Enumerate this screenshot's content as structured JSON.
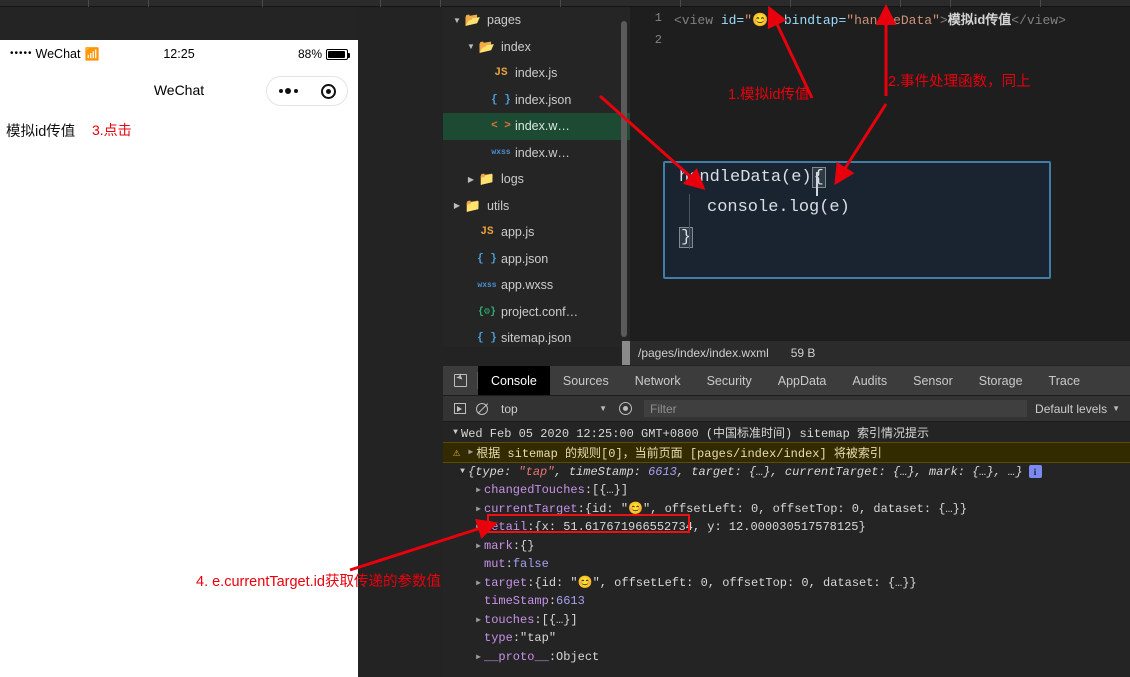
{
  "simulator": {
    "status_bar": {
      "signal_dots": "•••••",
      "carrier": "WeChat",
      "wifi_icon": "wifi-icon",
      "time": "12:25",
      "battery_percent": "88%",
      "battery_icon": "battery-icon"
    },
    "nav_title": "WeChat",
    "capsule": {
      "menu_icon": "more-dots-icon",
      "target_icon": "target-icon"
    },
    "page_text": "模拟id传值"
  },
  "file_tree": {
    "items": [
      {
        "label": "pages",
        "icon": "folder-open-icon",
        "depth": 0,
        "arrow": "down",
        "selected": false
      },
      {
        "label": "index",
        "icon": "folder-open-icon",
        "depth": 1,
        "arrow": "down",
        "selected": false
      },
      {
        "label": "index.js",
        "icon": "js-icon",
        "depth": 2,
        "arrow": "none",
        "selected": false
      },
      {
        "label": "index.json",
        "icon": "json-icon",
        "depth": 2,
        "arrow": "none",
        "selected": false
      },
      {
        "label": "index.w…",
        "icon": "wxml-icon",
        "depth": 2,
        "arrow": "none",
        "selected": true
      },
      {
        "label": "index.w…",
        "icon": "wxss-icon",
        "depth": 2,
        "arrow": "none",
        "selected": false
      },
      {
        "label": "logs",
        "icon": "folder-icon",
        "depth": 1,
        "arrow": "right",
        "selected": false
      },
      {
        "label": "utils",
        "icon": "folder-icon",
        "depth": 0,
        "arrow": "right",
        "selected": false
      },
      {
        "label": "app.js",
        "icon": "js-icon",
        "depth": 1,
        "arrow": "none",
        "selected": false
      },
      {
        "label": "app.json",
        "icon": "json-icon",
        "depth": 1,
        "arrow": "none",
        "selected": false
      },
      {
        "label": "app.wxss",
        "icon": "wxss-icon",
        "depth": 1,
        "arrow": "none",
        "selected": false
      },
      {
        "label": "project.conf…",
        "icon": "project-config-icon",
        "depth": 1,
        "arrow": "none",
        "selected": false
      },
      {
        "label": "sitemap.json",
        "icon": "json-icon",
        "depth": 1,
        "arrow": "none",
        "selected": false
      }
    ]
  },
  "editor": {
    "line1_number": "1",
    "line2_number": "2",
    "code": {
      "open_tag": "<view",
      "attr_id": "id=",
      "id_value": "\"😊\"",
      "attr_bindtap": "bindtap=",
      "bindtap_value": "\"handleData\"",
      "gt": ">",
      "inner_text": "模拟id传值",
      "close_tag": "</view>"
    },
    "status": {
      "path": "/pages/index/index.wxml",
      "size": "59 B"
    }
  },
  "code_callout": {
    "line1_a": "handleData(e)",
    "line1_brace": "{",
    "line2": "console.log(e)",
    "line3": "}"
  },
  "devtools": {
    "inspect_icon": "inspect-element-icon",
    "tabs": [
      {
        "label": "Console",
        "active": true
      },
      {
        "label": "Sources",
        "active": false
      },
      {
        "label": "Network",
        "active": false
      },
      {
        "label": "Security",
        "active": false
      },
      {
        "label": "AppData",
        "active": false
      },
      {
        "label": "Audits",
        "active": false
      },
      {
        "label": "Sensor",
        "active": false
      },
      {
        "label": "Storage",
        "active": false
      },
      {
        "label": "Trace",
        "active": false
      }
    ],
    "toolbar": {
      "execute_icon": "execution-context-icon",
      "clear_icon": "clear-console-icon",
      "context": "top",
      "eye_icon": "live-expression-icon",
      "filter_placeholder": "Filter",
      "levels": "Default levels"
    },
    "console": {
      "group_header": "Wed Feb 05 2020 12:25:00 GMT+0800 (中国标准时间) sitemap 索引情况提示",
      "warning": "根据 sitemap 的规则[0]，当前页面 [pages/index/index] 将被索引",
      "object_summary": {
        "p1_key": "{type: ",
        "p1_val": "\"tap\"",
        "p2": ", timeStamp: ",
        "p2_val": "6613",
        "p3": ", target: {…}, currentTarget: {…}, mark: {…}, …}"
      },
      "rows": [
        {
          "indent": 2,
          "arrow": true,
          "key": "changedTouches",
          "sep": ": ",
          "value": "[{…}]"
        },
        {
          "indent": 2,
          "arrow": true,
          "key": "currentTarget",
          "sep": ": ",
          "value": "{id: \"😊\", offsetLeft: 0, offsetTop: 0, dataset: {…}}"
        },
        {
          "indent": 2,
          "arrow": true,
          "key": "detail",
          "sep": ": ",
          "value": "{x: 51.617671966552734, y: 12.000030517578125}"
        },
        {
          "indent": 2,
          "arrow": true,
          "key": "mark",
          "sep": ": ",
          "value": "{}"
        },
        {
          "indent": 2,
          "arrow": false,
          "key": "mut",
          "sep": ": ",
          "value": "false"
        },
        {
          "indent": 2,
          "arrow": true,
          "key": "target",
          "sep": ": ",
          "value": "{id: \"😊\", offsetLeft: 0, offsetTop: 0, dataset: {…}}"
        },
        {
          "indent": 2,
          "arrow": false,
          "key": "timeStamp",
          "sep": ": ",
          "value": "6613"
        },
        {
          "indent": 2,
          "arrow": true,
          "key": "touches",
          "sep": ": ",
          "value": "[{…}]"
        },
        {
          "indent": 2,
          "arrow": false,
          "key": "type",
          "sep": ": ",
          "value": "\"tap\""
        },
        {
          "indent": 2,
          "arrow": true,
          "key": "__proto__",
          "sep": ": ",
          "value": "Object"
        }
      ],
      "info_badge": "i"
    }
  },
  "annotations": {
    "color": "#e8000d",
    "items": [
      {
        "id": "ann-1",
        "text": "1.模拟id传值"
      },
      {
        "id": "ann-2",
        "text": "2.事件处理函数，同上"
      },
      {
        "id": "ann-3",
        "text": "3.点击"
      },
      {
        "id": "ann-4",
        "text": "4. e.currentTarget.id获取传递的参数值"
      }
    ]
  }
}
